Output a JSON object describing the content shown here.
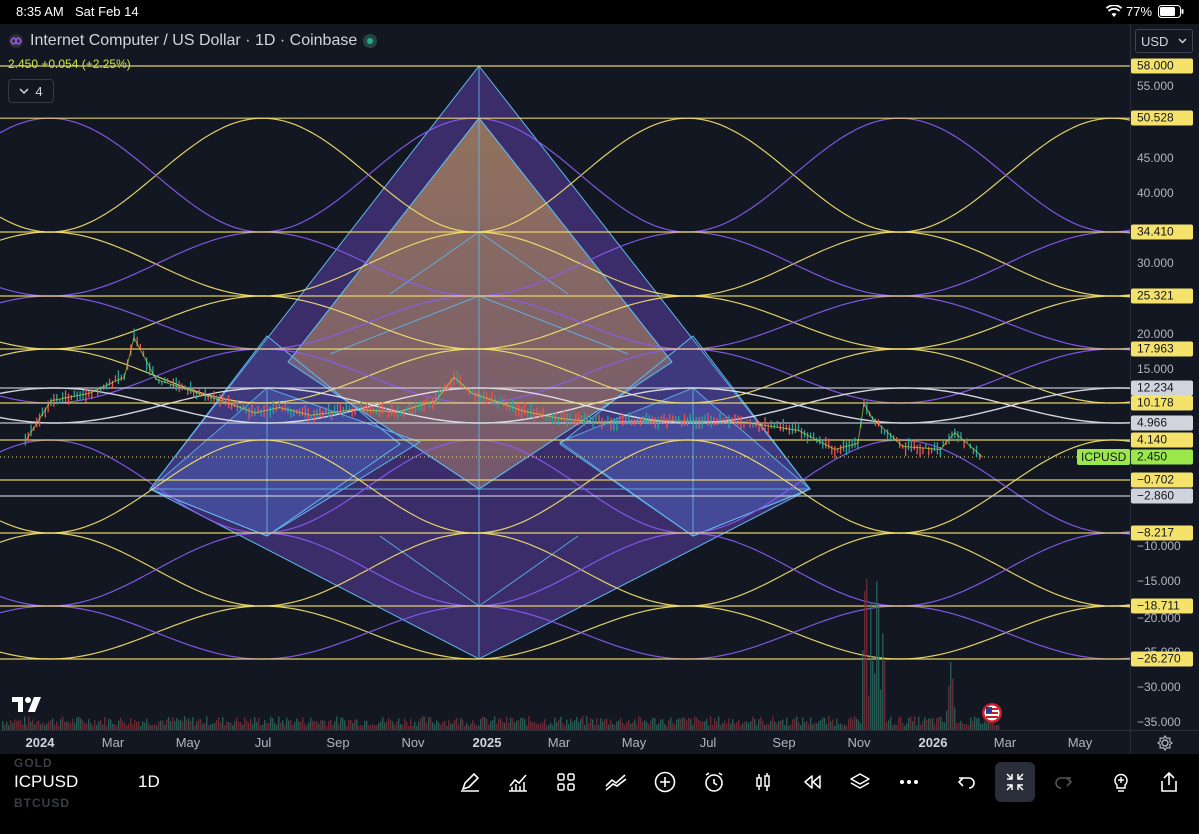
{
  "status_bar": {
    "time": "8:35 AM",
    "date": "Sat Feb 14",
    "battery": "77%"
  },
  "legend": {
    "title": "Internet Computer / US Dollar · 1D · Coinbase",
    "ohlc": "2.450 +0.054 (+2.25%)",
    "indicator_count": "4"
  },
  "currency": "USD",
  "chart_data": {
    "type": "line",
    "title": "Internet Computer / US Dollar · 1D · Coinbase",
    "symbol": "ICPUSD",
    "interval": "1D",
    "xlabel": "",
    "ylabel": "",
    "y_axis_ticks": [
      "55.000",
      "45.000",
      "40.000",
      "30.000",
      "20.000",
      "15.000",
      "−10.000",
      "−15.000",
      "−20.000",
      "−25.000",
      "−30.000",
      "−35.000"
    ],
    "ylim": [
      -35,
      58
    ],
    "x_axis_ticks": [
      "2024",
      "Mar",
      "May",
      "Jul",
      "Sep",
      "Nov",
      "2025",
      "Mar",
      "May",
      "Jul",
      "Sep",
      "Nov",
      "2026",
      "Mar",
      "May"
    ],
    "price_levels": [
      {
        "label": "58.000",
        "value": 58.0,
        "color": "#f5e26b"
      },
      {
        "label": "50.528",
        "value": 50.528,
        "color": "#f5e26b"
      },
      {
        "label": "34.410",
        "value": 34.41,
        "color": "#f5e26b"
      },
      {
        "label": "25.321",
        "value": 25.321,
        "color": "#f5e26b"
      },
      {
        "label": "17.963",
        "value": 17.963,
        "color": "#f5e26b"
      },
      {
        "label": "12.234",
        "value": 12.234,
        "color": "#d1d4dc"
      },
      {
        "label": "10.178",
        "value": 10.178,
        "color": "#f5e26b"
      },
      {
        "label": "4.966",
        "value": 4.966,
        "color": "#d1d4dc"
      },
      {
        "label": "4.140",
        "value": 4.14,
        "color": "#f5e26b"
      },
      {
        "label": "−0.702",
        "value": -0.702,
        "color": "#f5e26b"
      },
      {
        "label": "−2.860",
        "value": -2.86,
        "color": "#d1d4dc"
      },
      {
        "label": "−8.217",
        "value": -8.217,
        "color": "#f5e26b"
      },
      {
        "label": "−18.711",
        "value": -18.711,
        "color": "#f5e26b"
      },
      {
        "label": "−26.270",
        "value": -26.27,
        "color": "#f5e26b"
      }
    ],
    "last_price": {
      "symbol": "ICPUSD",
      "value": 2.45,
      "label": "2.450"
    },
    "series": [
      {
        "values": [
          [
            "2023-12-20",
            4.0
          ],
          [
            "2024-01-10",
            10.5
          ],
          [
            "2024-02-10",
            11.5
          ],
          [
            "2024-03-10",
            13.8
          ],
          [
            "2024-03-18",
            19.5
          ],
          [
            "2024-04-05",
            13.5
          ],
          [
            "2024-05-01",
            12.0
          ],
          [
            "2024-06-01",
            10.3
          ],
          [
            "2024-06-25",
            7.6
          ],
          [
            "2024-07-15",
            9.0
          ],
          [
            "2024-08-10",
            7.0
          ],
          [
            "2024-09-15",
            8.5
          ],
          [
            "2024-10-20",
            7.8
          ],
          [
            "2024-11-20",
            10.5
          ],
          [
            "2024-12-05",
            13.8
          ],
          [
            "2024-12-20",
            11.5
          ],
          [
            "2025-01-10",
            10.3
          ],
          [
            "2025-02-01",
            8.0
          ],
          [
            "2025-03-01",
            6.2
          ],
          [
            "2025-04-01",
            5.2
          ],
          [
            "2025-05-15",
            5.5
          ],
          [
            "2025-06-25",
            5.4
          ],
          [
            "2025-08-01",
            5.2
          ],
          [
            "2025-09-15",
            4.6
          ],
          [
            "2025-10-15",
            3.2
          ],
          [
            "2025-11-03",
            3.8
          ],
          [
            "2025-11-08",
            10.0
          ],
          [
            "2025-11-15",
            6.2
          ],
          [
            "2025-12-10",
            3.5
          ],
          [
            "2026-01-10",
            3.2
          ],
          [
            "2026-01-22",
            4.5
          ],
          [
            "2026-02-14",
            2.45
          ]
        ]
      }
    ]
  },
  "toolbar": {
    "symbol": "ICPUSD",
    "interval": "1D",
    "ghost_top": "GOLD",
    "ghost_bottom": "BTCUSD"
  }
}
